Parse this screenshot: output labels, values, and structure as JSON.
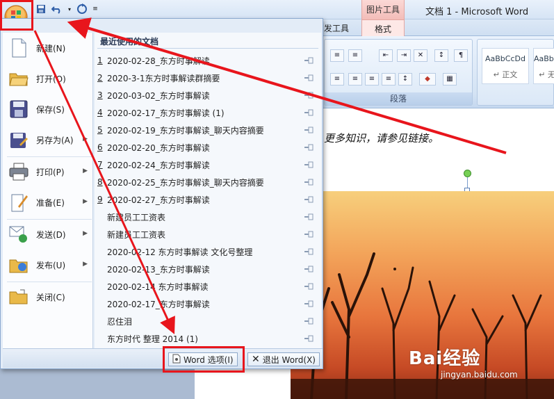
{
  "window": {
    "title": "文档 1 - Microsoft Word",
    "context_tab_group": "图片工具"
  },
  "ribbon": {
    "tabs": [
      "发工具",
      "格式"
    ],
    "paragraph_group_label": "段落",
    "styles": [
      {
        "sample": "AaBbCcDd",
        "name": "↵ 正文"
      },
      {
        "sample": "AaBbCcDd",
        "name": "↵ 无"
      }
    ]
  },
  "office_menu": {
    "items": [
      {
        "label": "新建(N)",
        "icon": "new-document-icon",
        "submenu": false
      },
      {
        "label": "打开(O)",
        "icon": "open-folder-icon",
        "submenu": false
      },
      {
        "label": "保存(S)",
        "icon": "save-disk-icon",
        "submenu": false
      },
      {
        "label": "另存为(A)",
        "icon": "save-as-icon",
        "submenu": true
      },
      {
        "label": "打印(P)",
        "icon": "printer-icon",
        "submenu": true
      },
      {
        "label": "准备(E)",
        "icon": "prepare-icon",
        "submenu": true
      },
      {
        "label": "发送(D)",
        "icon": "send-icon",
        "submenu": true
      },
      {
        "label": "发布(U)",
        "icon": "publish-icon",
        "submenu": true
      },
      {
        "label": "关闭(C)",
        "icon": "close-folder-icon",
        "submenu": false
      }
    ],
    "recent_header": "最近使用的文档",
    "recent": [
      {
        "num": "1",
        "name": "2020-02-28_东方时事解读"
      },
      {
        "num": "2",
        "name": "2020-3-1东方时事解读群摘要"
      },
      {
        "num": "3",
        "name": "2020-03-02_东方时事解读"
      },
      {
        "num": "4",
        "name": "2020-02-17_东方时事解读 (1)"
      },
      {
        "num": "5",
        "name": "2020-02-19_东方时事解读_聊天内容摘要"
      },
      {
        "num": "6",
        "name": "2020-02-20_东方时事解读"
      },
      {
        "num": "7",
        "name": "2020-02-24_东方时事解读"
      },
      {
        "num": "8",
        "name": "2020-02-25_东方时事解读_聊天内容摘要"
      },
      {
        "num": "9",
        "name": "2020-02-27_东方时事解读"
      },
      {
        "num": "",
        "name": "新建员工工资表"
      },
      {
        "num": "",
        "name": "新建员工工资表"
      },
      {
        "num": "",
        "name": "2020-02-12  东方时事解读 文化号整理"
      },
      {
        "num": "",
        "name": "2020-02-13_东方时事解读"
      },
      {
        "num": "",
        "name": "2020-02-14  东方时事解读"
      },
      {
        "num": "",
        "name": "2020-02-17_东方时事解读"
      },
      {
        "num": "",
        "name": "忍住泪"
      },
      {
        "num": "",
        "name": "东方时代 整理  2014  (1)"
      }
    ],
    "word_options_label": "Word 选项(I)",
    "exit_word_label": "退出 Word(X)"
  },
  "document": {
    "visible_text": "更多知识，请参见链接。"
  },
  "watermark": {
    "brand": "Bai经验",
    "url": "jingyan.baidu.com"
  },
  "colors": {
    "annotation_red": "#e8151c",
    "ribbon_blue": "#d4e3f4",
    "context_tab": "#f3bdb8"
  }
}
